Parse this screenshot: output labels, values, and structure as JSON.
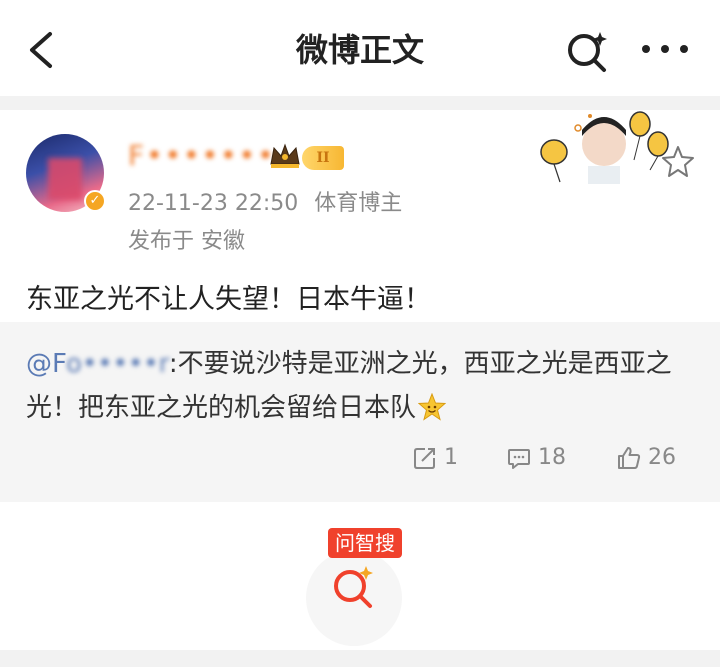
{
  "nav": {
    "title": "微博正文",
    "icons": [
      "back-arrow-icon",
      "smart-search-icon",
      "more-dots-icon"
    ]
  },
  "post": {
    "author": "F•••••••",
    "level_badge": "II",
    "timestamp": "22-11-23 22:50",
    "role": "体育博主",
    "location": "发布于 安徽",
    "content": "东亚之光不让人失望！日本牛逼！",
    "verified_badge": "✓"
  },
  "quote": {
    "mention_prefix": "@F",
    "mention_blurred": "o•••••r",
    "text": ":不要说沙特是亚洲之光，西亚之光是西亚之光！把东亚之光的机会留给日本队",
    "emoji": "smiling-face-emoji"
  },
  "stats": {
    "repost": "1",
    "comment": "18",
    "like": "26"
  },
  "bottom": {
    "search_label": "问智搜"
  },
  "colors": {
    "accent_orange": "#f07a2a",
    "mention_blue": "#5b7bb5",
    "brand_red": "#f0412c"
  }
}
